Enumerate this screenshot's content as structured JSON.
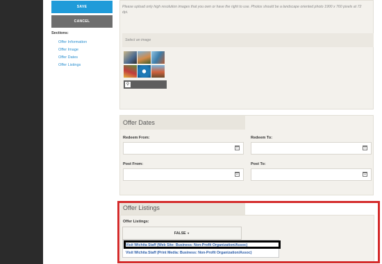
{
  "actions": {
    "save_label": "SAVE",
    "cancel_label": "CANCEL"
  },
  "sidebar": {
    "title": "Sections:",
    "items": [
      {
        "label": "Offer Information"
      },
      {
        "label": "Offer Image"
      },
      {
        "label": "Offer Dates"
      },
      {
        "label": "Offer Listings"
      }
    ]
  },
  "image_section": {
    "note": "Please upload only high resolution images that you own or have the right to use. Photos should be a landscape oriented photo 1900 x 760 pixels at 72 dpi.",
    "select_label": "Select an image",
    "zoom_icon": "magnifier-icon"
  },
  "offer_dates": {
    "title": "Offer Dates",
    "redeem_from_label": "Redeem From:",
    "redeem_to_label": "Redeem To:",
    "post_from_label": "Post From:",
    "post_to_label": "Post To:",
    "calendar_icon": "calendar-icon"
  },
  "offer_listings": {
    "title": "Offer Listings",
    "field_label": "Offer Listings:",
    "dropdown_value": "FALSE",
    "options": [
      {
        "label": "Visit Wichita Staff (Web Site: Business: Non-Profit Organization/Assoc)"
      },
      {
        "label": "Visit Wichita Staff (Print Media: Business: Non-Profit Organization/Assoc)"
      }
    ]
  },
  "colors": {
    "save": "#1f9bd9",
    "cancel": "#6e6e6e",
    "link": "#2a8fd0",
    "highlight_box": "#d42a2a"
  }
}
